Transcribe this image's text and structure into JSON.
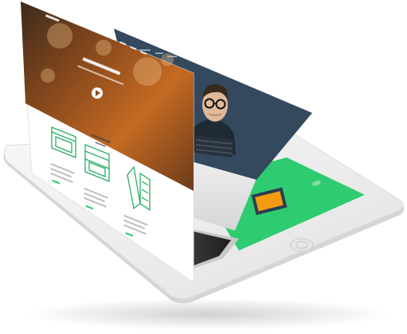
{
  "colors": {
    "tablet_body": "#eeeeee",
    "tablet_edge": "#d8d8d8",
    "card_navy": "#34495e",
    "card_green": "#2ecc71",
    "card_gray": "#e8e8e8",
    "hero_warm": "#b5621a",
    "line_green": "#27ae60"
  },
  "icons": {
    "home_button": "home-button-icon",
    "play": "play-icon",
    "browser": "browser-window-icon",
    "layout": "layout-wireframe-icon",
    "pencil": "pencil-ruler-icon"
  }
}
